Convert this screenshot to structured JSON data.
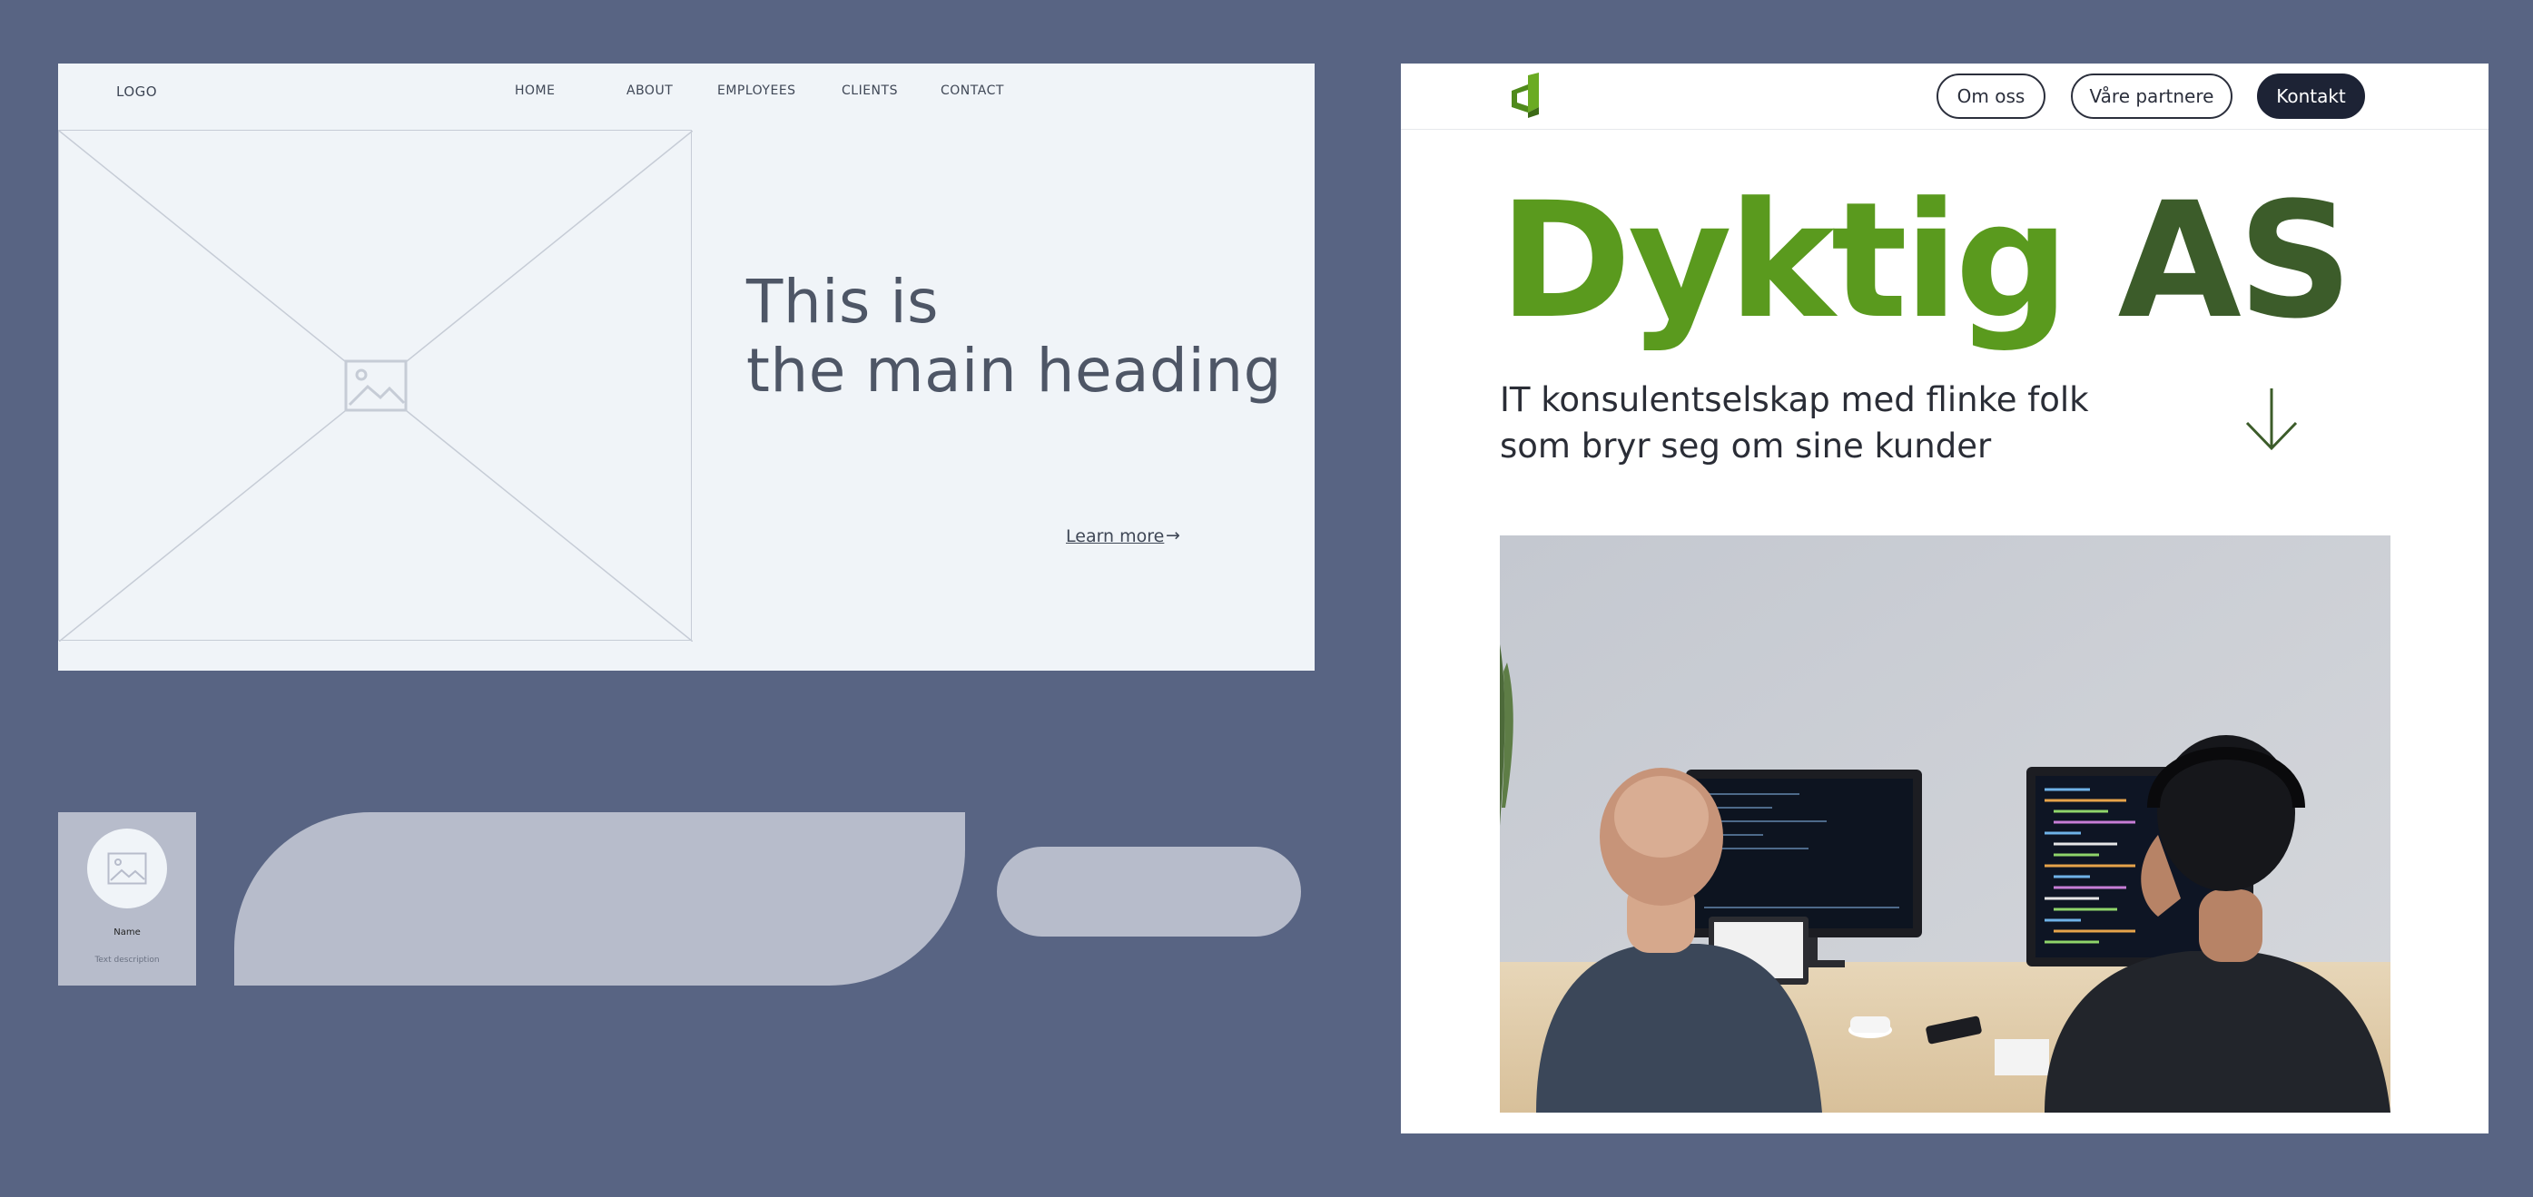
{
  "wireframe": {
    "logo": "LOGO",
    "nav": [
      "HOME",
      "ABOUT",
      "EMPLOYEES",
      "CLIENTS",
      "CONTACT"
    ],
    "heading_line1": "This is",
    "heading_line2": "the main heading",
    "learn_more": "Learn more",
    "arrow": "→"
  },
  "card": {
    "name": "Name",
    "description": "Text description"
  },
  "site": {
    "nav": {
      "om_oss": "Om oss",
      "vare_partnere": "Våre partnere",
      "kontakt": "Kontakt"
    },
    "title_part1": "Dyktig",
    "title_part2": "AS",
    "subtitle_line1": "IT konsulentselskap med flinke folk",
    "subtitle_line2": "som bryr seg om sine kunder",
    "colors": {
      "green": "#5a9a1e",
      "dark_green": "#3c5c2a",
      "dark_button": "#1d2335"
    }
  }
}
